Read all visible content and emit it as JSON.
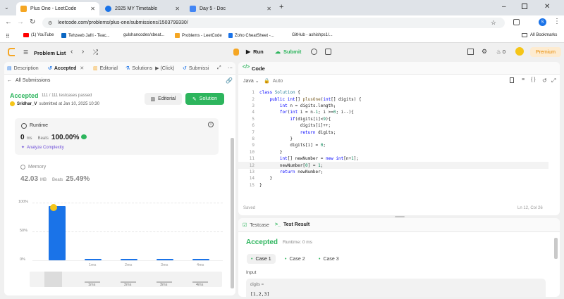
{
  "browser": {
    "tabs": [
      {
        "title": "Plus One - LeetCode",
        "color": "#f5a623"
      },
      {
        "title": "2025 MY Timetable",
        "color": "#1a73e8"
      },
      {
        "title": "Day 5 - Doc",
        "color": "#4285f4"
      }
    ],
    "new_tab": "+",
    "url": "leetcode.com/problems/plus-one/submissions/1503799330/",
    "profile_initial": "S",
    "bookmarks": [
      {
        "label": "(1) YouTube",
        "color": "#ff0000"
      },
      {
        "label": "Tehzeeb Jafri - Teac...",
        "color": "#0a66c2"
      },
      {
        "label": "gulshancodes/xbeat...",
        "color": "#333333"
      },
      {
        "label": "Problems - LeetCode",
        "color": "#f5a623"
      },
      {
        "label": "Zoho CheatSheet -...",
        "color": "#1a73e8"
      },
      {
        "label": "GitHub - ashishps1/...",
        "color": "#333333"
      }
    ],
    "all_bookmarks": "All Bookmarks"
  },
  "toolbar": {
    "problem_list": "Problem List",
    "run": "Run",
    "submit": "Submit",
    "streak": "0",
    "premium": "Premium"
  },
  "left_tabs": {
    "description": "Description",
    "accepted": "Accepted",
    "editorial": "Editorial",
    "solutions": "Solutions",
    "click": "(Click)",
    "submissions": "Submissi"
  },
  "submission": {
    "all_submissions": "All Submissions",
    "status": "Accepted",
    "passed": "111 / 111 testcases passed",
    "user": "Sridhar_V",
    "submitted": "submitted at Jan 10, 2025 10:30",
    "editorial_btn": "Editorial",
    "solution_btn": "Solution",
    "runtime_label": "Runtime",
    "runtime_value": "0",
    "runtime_unit": "ms",
    "beats_label": "Beats",
    "beats_runtime": "100.00%",
    "analyze": "Analyze Complexity",
    "memory_label": "Memory",
    "memory_value": "42.03",
    "memory_unit": "MB",
    "beats_memory": "25.49%"
  },
  "chart_data": {
    "type": "bar",
    "y_ticks": [
      "100%",
      "50%",
      "0%"
    ],
    "categories": [
      "0ms",
      "1ms",
      "2ms",
      "3ms",
      "4ms"
    ],
    "values": [
      94,
      3,
      3,
      3,
      3
    ],
    "ylim": [
      0,
      100
    ],
    "color": "#1a73e8",
    "x_labels_visible": [
      "1ms",
      "2ms",
      "3ms",
      "4ms"
    ],
    "mini_labels": [
      "1ms",
      "2ms",
      "3ms",
      "4ms"
    ]
  },
  "code": {
    "title": "Code",
    "language": "Java",
    "auto": "Auto",
    "saved": "Saved",
    "cursor": "Ln 12, Col 26",
    "lines": [
      "class Solution {",
      "    public int[] plusOne(int[] digits) {",
      "        int n = digits.length;",
      "        for(int i = n-1; i >=0; i--){",
      "            if(digits[i]<9){",
      "                digits[i]++;",
      "                return digits;",
      "            }",
      "            digits[i] = 0;",
      "        }",
      "        int[] newNumber = new int[n+1];",
      "        newNumber[0] = 1;",
      "        return newNumber;",
      "    }",
      "}"
    ]
  },
  "result": {
    "testcase_tab": "Testcase",
    "testresult_tab": "Test Result",
    "status": "Accepted",
    "runtime": "Runtime: 0 ms",
    "cases": [
      "Case 1",
      "Case 2",
      "Case 3"
    ],
    "input_label": "Input",
    "var_name": "digits =",
    "var_value": "[1,2,3]"
  }
}
